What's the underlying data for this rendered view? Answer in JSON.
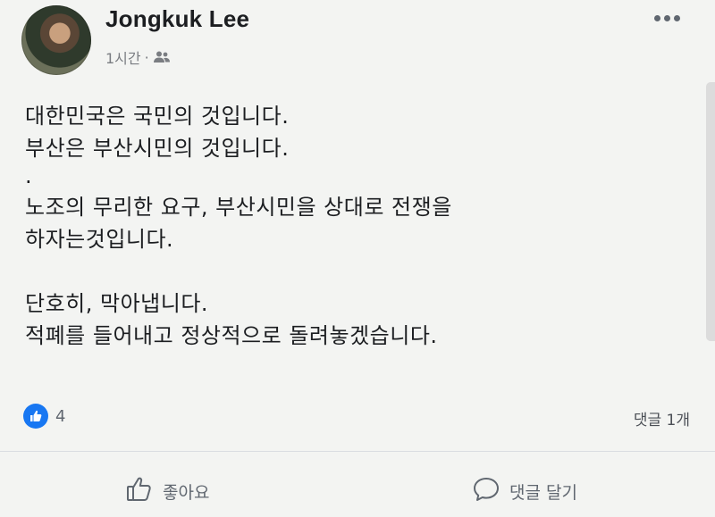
{
  "post": {
    "author": "Jongkuk Lee",
    "time": "1시간",
    "separator": "·",
    "audience_icon": "friends-icon",
    "more_icon": "more-horizontal-icon",
    "lines": [
      "대한민국은 국민의 것입니다.",
      "부산은 부산시민의 것입니다.",
      ".",
      "노조의 무리한 요구, 부산시민을 상대로 전쟁을",
      "하자는것입니다.",
      "",
      "단호히, 막아냅니다.",
      "적폐를 들어내고 정상적으로 돌려놓겠습니다."
    ],
    "reactions": {
      "icon": "like-badge-icon",
      "count": "4"
    },
    "comment_count": "댓글 1개",
    "actions": {
      "like_label": "좋아요",
      "comment_label": "댓글 달기"
    },
    "colors": {
      "accent": "#1877f2",
      "text": "#1c1e21",
      "muted": "#606770"
    }
  }
}
